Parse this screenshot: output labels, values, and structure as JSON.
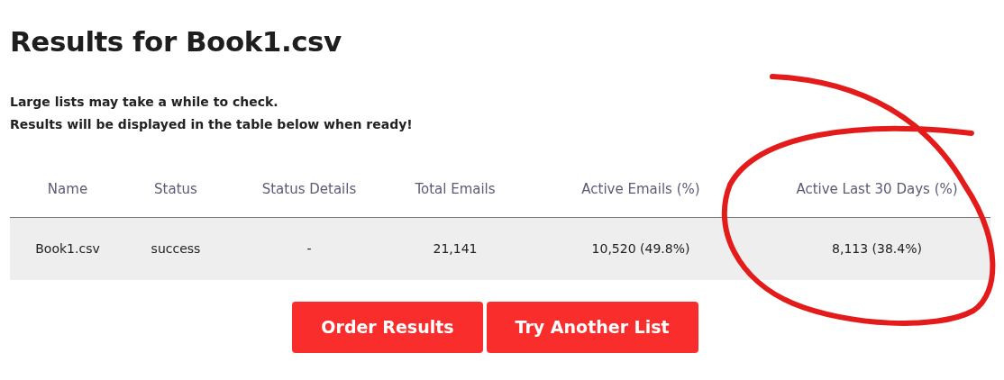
{
  "heading": "Results for Book1.csv",
  "notes": [
    "Large lists may take a while to check.",
    "Results will be displayed in the table below when ready!"
  ],
  "table": {
    "columns": [
      "Name",
      "Status",
      "Status Details",
      "Total Emails",
      "Active Emails (%)",
      "Active Last 30 Days (%)"
    ],
    "rows": [
      [
        "Book1.csv",
        "success",
        "-",
        "21,141",
        "10,520 (49.8%)",
        "8,113 (38.4%)"
      ]
    ]
  },
  "buttons": [
    "Order Results",
    "Try Another List"
  ],
  "annotation": {
    "kind": "circle",
    "color": "#e31b1b"
  }
}
